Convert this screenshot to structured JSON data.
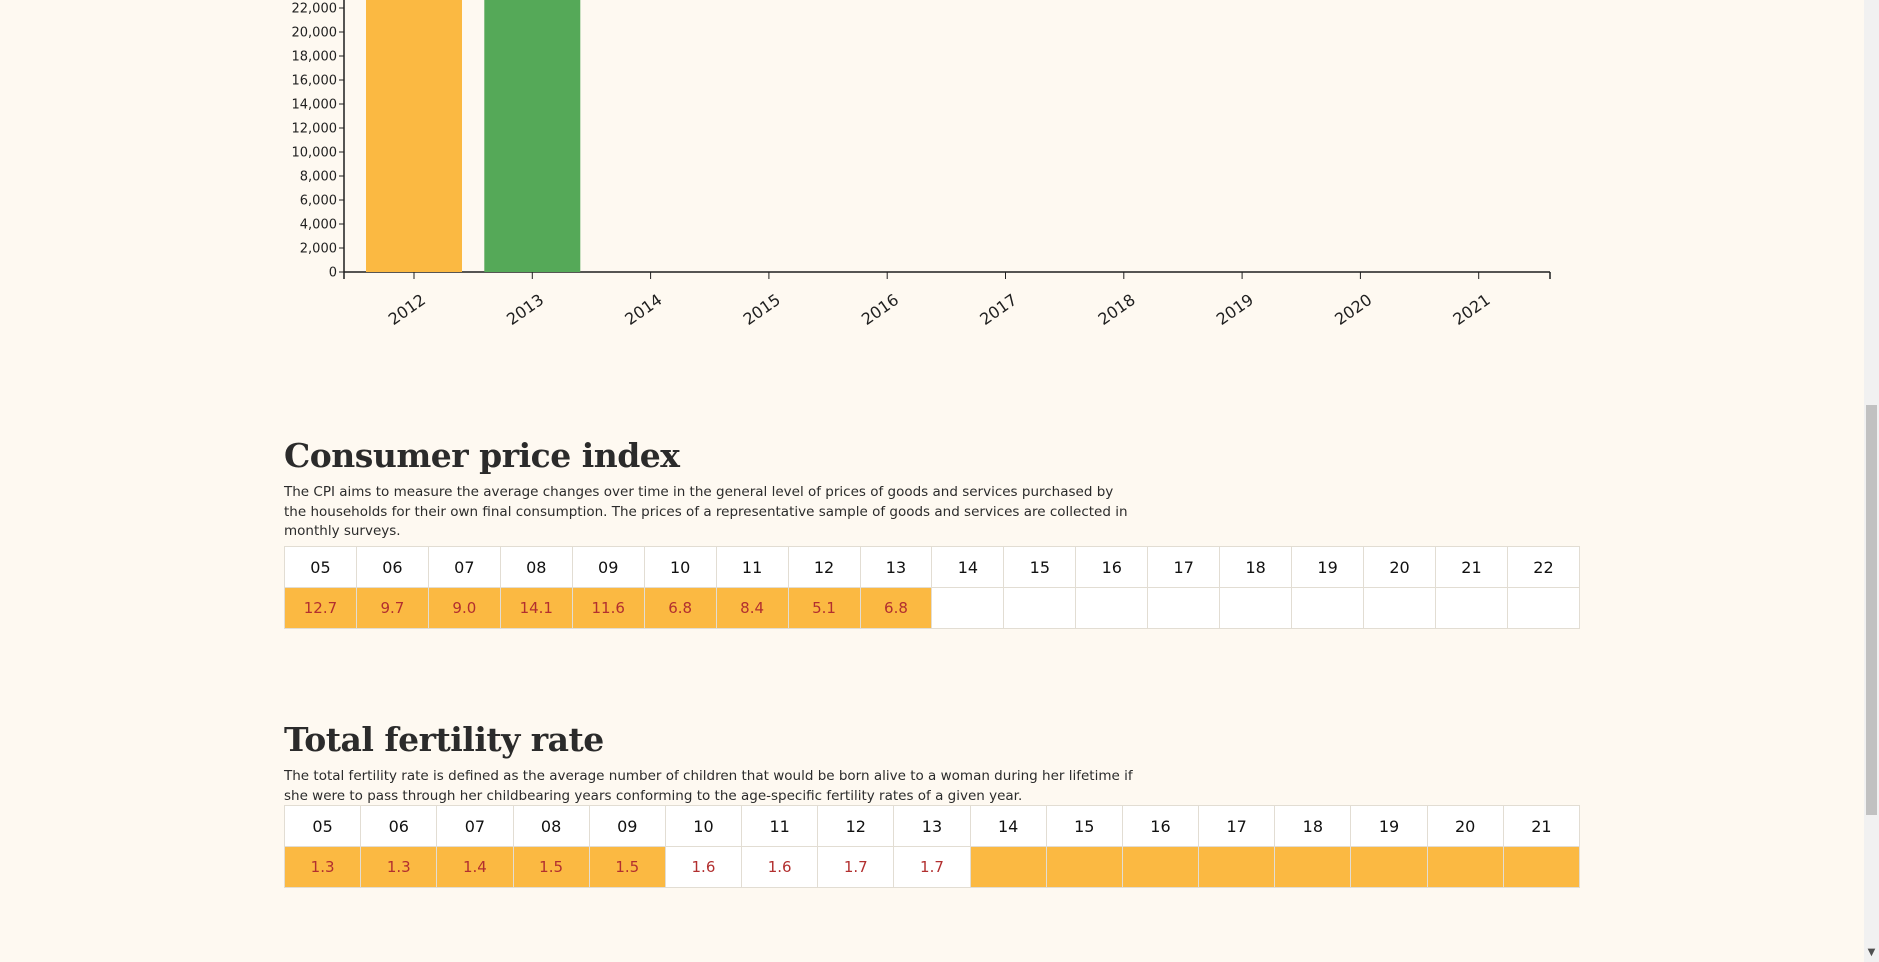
{
  "chart_data": {
    "type": "bar",
    "categories": [
      "2012",
      "2013",
      "2014",
      "2015",
      "2016",
      "2017",
      "2018",
      "2019",
      "2020",
      "2021"
    ],
    "values": [
      22000,
      22000,
      null,
      null,
      null,
      null,
      null,
      null,
      null,
      null
    ],
    "bar_colors": [
      "#fbb942",
      "#55a958"
    ],
    "yticks": [
      "0",
      "2,000",
      "4,000",
      "6,000",
      "8,000",
      "10,000",
      "12,000",
      "14,000",
      "16,000",
      "18,000",
      "20,000",
      "22,000"
    ],
    "ytick_values": [
      0,
      2000,
      4000,
      6000,
      8000,
      10000,
      12000,
      14000,
      16000,
      18000,
      20000,
      22000
    ],
    "ylim": [
      0,
      22000
    ],
    "grid": false,
    "legend": "none"
  },
  "cpi": {
    "title": "Consumer price index",
    "description": "The CPI aims to measure the average changes over time in the general level of prices of goods and services purchased by the households for their own final consumption. The prices of a representative sample of goods and services are collected in monthly surveys.",
    "years": [
      "05",
      "06",
      "07",
      "08",
      "09",
      "10",
      "11",
      "12",
      "13",
      "14",
      "15",
      "16",
      "17",
      "18",
      "19",
      "20",
      "21",
      "22"
    ],
    "values": [
      "12.7",
      "9.7",
      "9.0",
      "14.1",
      "11.6",
      "6.8",
      "8.4",
      "5.1",
      "6.8",
      "",
      "",
      "",
      "",
      "",
      "",
      "",
      "",
      ""
    ],
    "highlighted": [
      true,
      true,
      true,
      true,
      true,
      true,
      true,
      true,
      true,
      false,
      false,
      false,
      false,
      false,
      false,
      false,
      false,
      false
    ]
  },
  "fertility": {
    "title": "Total fertility rate",
    "description": "The total fertility rate is defined as the average number of children that would be born alive to a woman during her lifetime if she were to pass through her childbearing years conforming to the age-specific fertility rates of a given year.",
    "years": [
      "05",
      "06",
      "07",
      "08",
      "09",
      "10",
      "11",
      "12",
      "13",
      "14",
      "15",
      "16",
      "17",
      "18",
      "19",
      "20",
      "21"
    ],
    "values": [
      "1.3",
      "1.3",
      "1.4",
      "1.5",
      "1.5",
      "1.6",
      "1.6",
      "1.7",
      "1.7",
      "",
      "",
      "",
      "",
      "",
      "",
      "",
      ""
    ],
    "highlighted": [
      true,
      true,
      true,
      true,
      true,
      false,
      false,
      false,
      false,
      true,
      true,
      true,
      true,
      true,
      true,
      true,
      true
    ]
  },
  "colors": {
    "background": "#fef9f1",
    "highlight": "#fbb942",
    "value_text": "#b22f2f",
    "bar_green": "#55a958"
  }
}
